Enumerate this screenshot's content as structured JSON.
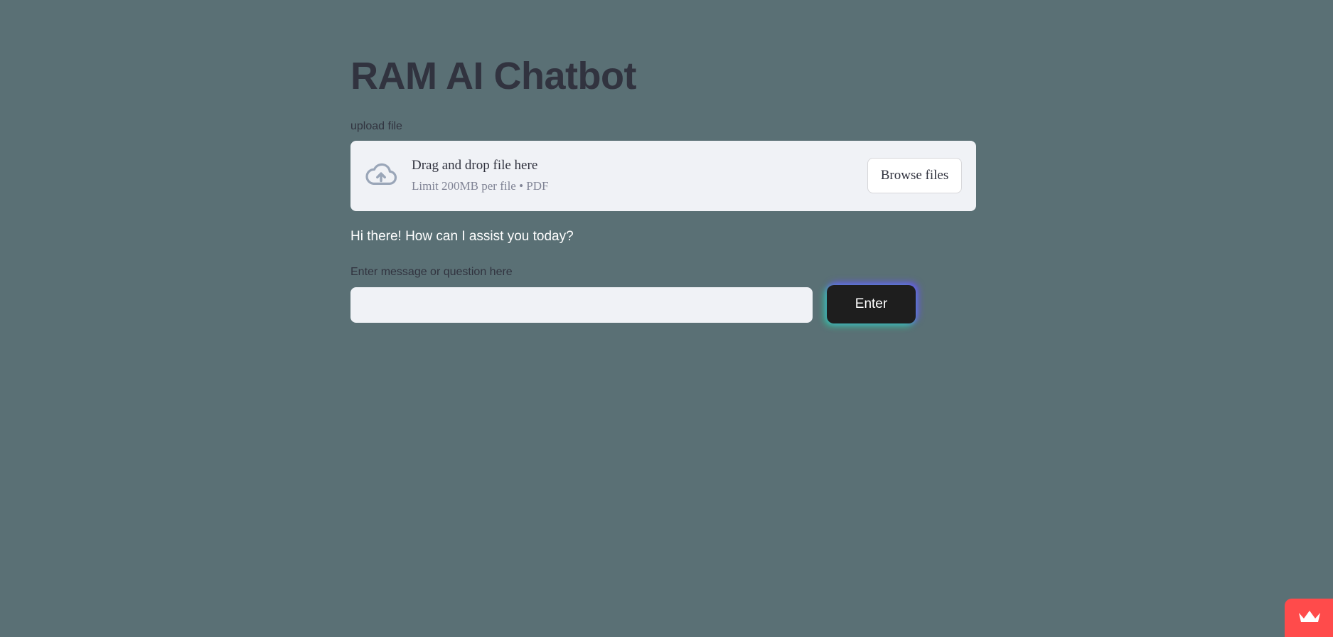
{
  "app": {
    "title": "RAM AI Chatbot"
  },
  "uploader": {
    "label": "upload file",
    "drop_title": "Drag and drop file here",
    "drop_subtitle": "Limit 200MB per file • PDF",
    "browse_label": "Browse files",
    "icon": "cloud-upload-icon"
  },
  "chat": {
    "greeting": "Hi there! How can I assist you today?",
    "input_label": "Enter message or question here",
    "input_value": "",
    "enter_label": "Enter"
  },
  "badge": {
    "icon": "crown-icon"
  },
  "colors": {
    "background": "#5a7075",
    "panel": "#f0f2f6",
    "text_dark": "#31333f",
    "button_dark": "#1e1e1e",
    "badge": "#ff4b4b"
  }
}
